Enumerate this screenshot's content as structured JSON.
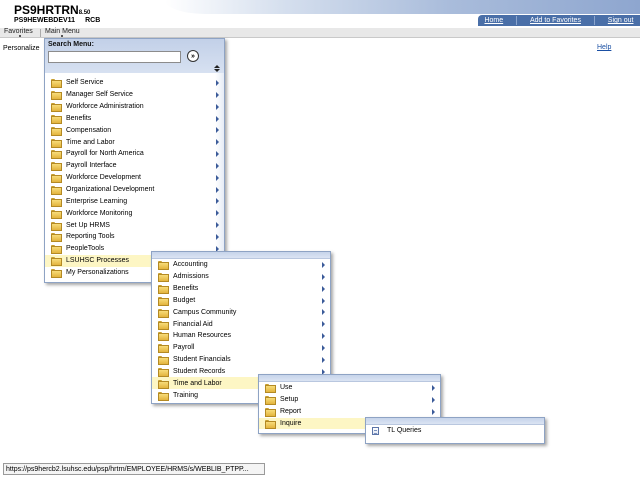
{
  "header": {
    "app_title": "PS9HRTRN",
    "version": "8.50",
    "db_name": "PS9HEWEBDEV11",
    "user": "RCB",
    "links": {
      "home": "Home",
      "add_favorites": "Add to Favorites",
      "sign_out": "Sign out"
    }
  },
  "menubar": {
    "favorites": "Favorites",
    "main_menu": "Main Menu"
  },
  "page": {
    "personalize": "Personalize",
    "help": "Help"
  },
  "main_menu": {
    "search_label": "Search Menu:",
    "search_value": "",
    "items": [
      {
        "label": "Self Service",
        "has_submenu": true
      },
      {
        "label": "Manager Self Service",
        "has_submenu": true
      },
      {
        "label": "Workforce Administration",
        "has_submenu": true
      },
      {
        "label": "Benefits",
        "has_submenu": true
      },
      {
        "label": "Compensation",
        "has_submenu": true
      },
      {
        "label": "Time and Labor",
        "has_submenu": true
      },
      {
        "label": "Payroll for North America",
        "has_submenu": true
      },
      {
        "label": "Payroll Interface",
        "has_submenu": true
      },
      {
        "label": "Workforce Development",
        "has_submenu": true
      },
      {
        "label": "Organizational Development",
        "has_submenu": true
      },
      {
        "label": "Enterprise Learning",
        "has_submenu": true
      },
      {
        "label": "Workforce Monitoring",
        "has_submenu": true
      },
      {
        "label": "Set Up HRMS",
        "has_submenu": true
      },
      {
        "label": "Reporting Tools",
        "has_submenu": true
      },
      {
        "label": "PeopleTools",
        "has_submenu": true
      },
      {
        "label": "LSUHSC Processes",
        "has_submenu": true,
        "active": true
      },
      {
        "label": "My Personalizations",
        "has_submenu": false
      }
    ]
  },
  "lsuhsc_menu": {
    "items": [
      {
        "label": "Accounting",
        "has_submenu": true
      },
      {
        "label": "Admissions",
        "has_submenu": true
      },
      {
        "label": "Benefits",
        "has_submenu": true
      },
      {
        "label": "Budget",
        "has_submenu": true
      },
      {
        "label": "Campus Community",
        "has_submenu": true
      },
      {
        "label": "Financial Aid",
        "has_submenu": true
      },
      {
        "label": "Human Resources",
        "has_submenu": true
      },
      {
        "label": "Payroll",
        "has_submenu": true
      },
      {
        "label": "Student Financials",
        "has_submenu": true
      },
      {
        "label": "Student Records",
        "has_submenu": true
      },
      {
        "label": "Time and Labor",
        "has_submenu": true,
        "active": true
      },
      {
        "label": "Training",
        "has_submenu": true
      }
    ]
  },
  "time_labor_menu": {
    "items": [
      {
        "label": "Use",
        "has_submenu": true
      },
      {
        "label": "Setup",
        "has_submenu": true
      },
      {
        "label": "Report",
        "has_submenu": true
      },
      {
        "label": "Inquire",
        "has_submenu": true,
        "active": true
      }
    ]
  },
  "inquire_menu": {
    "items": [
      {
        "label": "TL Queries",
        "type": "page"
      }
    ]
  },
  "status_bar": {
    "url": "https://ps9hercb2.lsuhsc.edu/psp/hrtrn/EMPLOYEE/HRMS/s/WEBLIB_PTPP..."
  },
  "colors": {
    "nav_bar": "#4a6fa8",
    "active_item": "#fdf6c4",
    "panel_border": "#8ea3c4",
    "link": "#1a4fa3"
  },
  "icons": {
    "folder": "folder-icon",
    "page": "page-icon",
    "submenu": "submenu-arrow-icon",
    "search_go": "search-go-icon",
    "sort": "sort-icon"
  }
}
